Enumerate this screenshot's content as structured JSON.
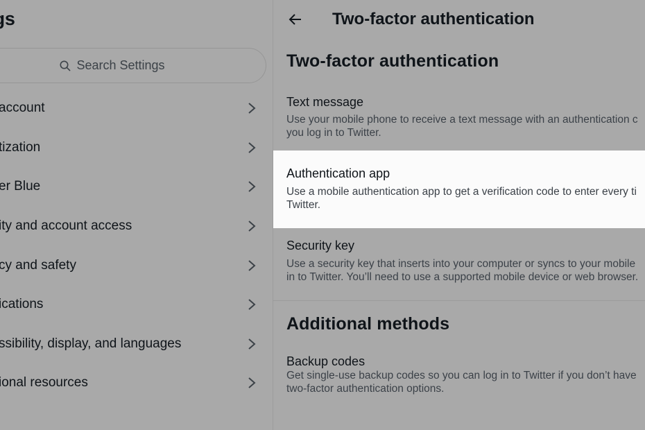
{
  "sidebar": {
    "title": "ings",
    "search_placeholder": "Search Settings",
    "items": [
      {
        "label": "account"
      },
      {
        "label": "tization"
      },
      {
        "label": "er Blue"
      },
      {
        "label": "ity and account access"
      },
      {
        "label": "cy and safety"
      },
      {
        "label": "ications"
      },
      {
        "label": "ssibility, display, and languages"
      },
      {
        "label": "ional resources"
      }
    ]
  },
  "main": {
    "header_title": "Two-factor authentication",
    "section_title": "Two-factor authentication",
    "options": [
      {
        "title": "Text message",
        "desc_line1": "Use your mobile phone to receive a text message with an authentication c",
        "desc_line2": "you log in to Twitter."
      },
      {
        "title": "Authentication app",
        "desc_line1": "Use a mobile authentication app to get a verification code to enter every ti",
        "desc_line2": "Twitter."
      },
      {
        "title": "Security key",
        "desc_line1": "Use a security key that inserts into your computer or syncs to your mobile",
        "desc_line2": "in to Twitter. You’ll need to use a supported mobile device or web browser."
      }
    ],
    "additional_title": "Additional methods",
    "backup": {
      "title": "Backup codes",
      "desc_line1": "Get single-use backup codes so you can log in to Twitter if you don’t have",
      "desc_line2": "two-factor authentication options."
    }
  },
  "colors": {
    "overlay_background": "#a9a9a9",
    "highlight_background": "#fbfbfb",
    "text_primary": "#0f1419",
    "text_secondary": "#3b4148"
  },
  "icons": {
    "search": "search-icon",
    "chevron": "chevron-right-icon",
    "back": "back-arrow-icon"
  }
}
